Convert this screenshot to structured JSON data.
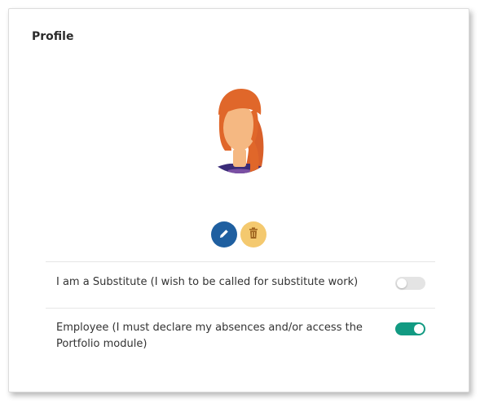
{
  "profile": {
    "title": "Profile",
    "avatar": {
      "hair_color": "#e0672a",
      "skin_color": "#f5b882",
      "shirt_color": "#7a4fa3",
      "collar_color": "#3a2b78"
    },
    "actions": {
      "edit_icon": "pencil-icon",
      "delete_icon": "trash-icon",
      "edit_color": "#1f5fa0",
      "delete_color": "#f4c96f"
    },
    "settings": [
      {
        "label": "I am a Substitute (I wish to be called for substitute work)",
        "enabled": false
      },
      {
        "label_line1": "Employee (I must declare my absences and/or access the",
        "label_line2": "Portfolio module)",
        "enabled": true
      }
    ],
    "toggle_on_color": "#129a82",
    "toggle_off_color": "#e4e4e4"
  }
}
